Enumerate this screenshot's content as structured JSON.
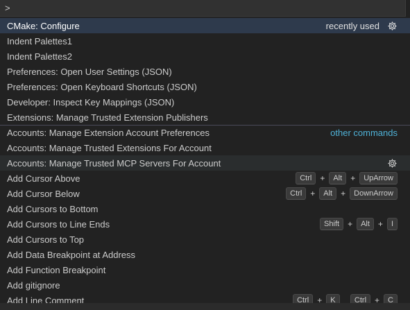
{
  "input": {
    "value": ">"
  },
  "recent": {
    "right_label": "recently used",
    "items": [
      {
        "label": "CMake: Configure"
      },
      {
        "label": "Indent Palettes1"
      },
      {
        "label": "Indent Palettes2"
      },
      {
        "label": "Preferences: Open User Settings (JSON)"
      },
      {
        "label": "Preferences: Open Keyboard Shortcuts (JSON)"
      },
      {
        "label": "Developer: Inspect Key Mappings (JSON)"
      },
      {
        "label": "Extensions: Manage Trusted Extension Publishers"
      }
    ]
  },
  "other": {
    "right_label": "other commands",
    "items": [
      {
        "label": "Accounts: Manage Extension Account Preferences"
      },
      {
        "label": "Accounts: Manage Trusted Extensions For Account"
      },
      {
        "label": "Accounts: Manage Trusted MCP Servers For Account"
      },
      {
        "label": "Add Cursor Above",
        "keys": [
          "Ctrl",
          "Alt",
          "UpArrow"
        ]
      },
      {
        "label": "Add Cursor Below",
        "keys": [
          "Ctrl",
          "Alt",
          "DownArrow"
        ]
      },
      {
        "label": "Add Cursors to Bottom"
      },
      {
        "label": "Add Cursors to Line Ends",
        "keys": [
          "Shift",
          "Alt",
          "I"
        ]
      },
      {
        "label": "Add Cursors to Top"
      },
      {
        "label": "Add Data Breakpoint at Address"
      },
      {
        "label": "Add Function Breakpoint"
      },
      {
        "label": "Add gitignore"
      },
      {
        "label": "Add Line Comment",
        "keys": [
          "Ctrl",
          "K",
          "Ctrl",
          "C"
        ]
      }
    ]
  },
  "icons": {
    "configure": "gear-icon"
  },
  "colors": {
    "selected_bg": "#2e3a4c",
    "hover_bg": "#2a2d2e",
    "other_commands": "#4fb3d9"
  }
}
